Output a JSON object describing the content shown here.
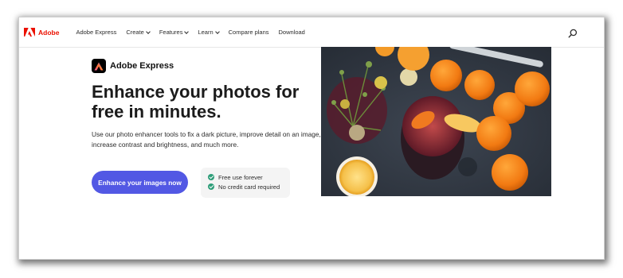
{
  "nav": {
    "brand": "Adobe",
    "items": [
      {
        "label": "Adobe Express",
        "dropdown": false
      },
      {
        "label": "Create",
        "dropdown": true
      },
      {
        "label": "Features",
        "dropdown": true
      },
      {
        "label": "Learn",
        "dropdown": true
      },
      {
        "label": "Compare plans",
        "dropdown": false
      },
      {
        "label": "Download",
        "dropdown": false
      }
    ],
    "search_icon": "search-icon"
  },
  "hero": {
    "app_name": "Adobe Express",
    "headline": "Enhance your photos for free in minutes.",
    "subtext": "Use our photo enhancer tools to fix a dark picture, improve detail on an image, increase contrast and brightness, and much more.",
    "cta_label": "Enhance your images now",
    "benefits": [
      "Free use forever",
      "No credit card required"
    ]
  },
  "colors": {
    "brand_red": "#eb1000",
    "cta": "#5258e4",
    "check": "#2d9d78"
  }
}
